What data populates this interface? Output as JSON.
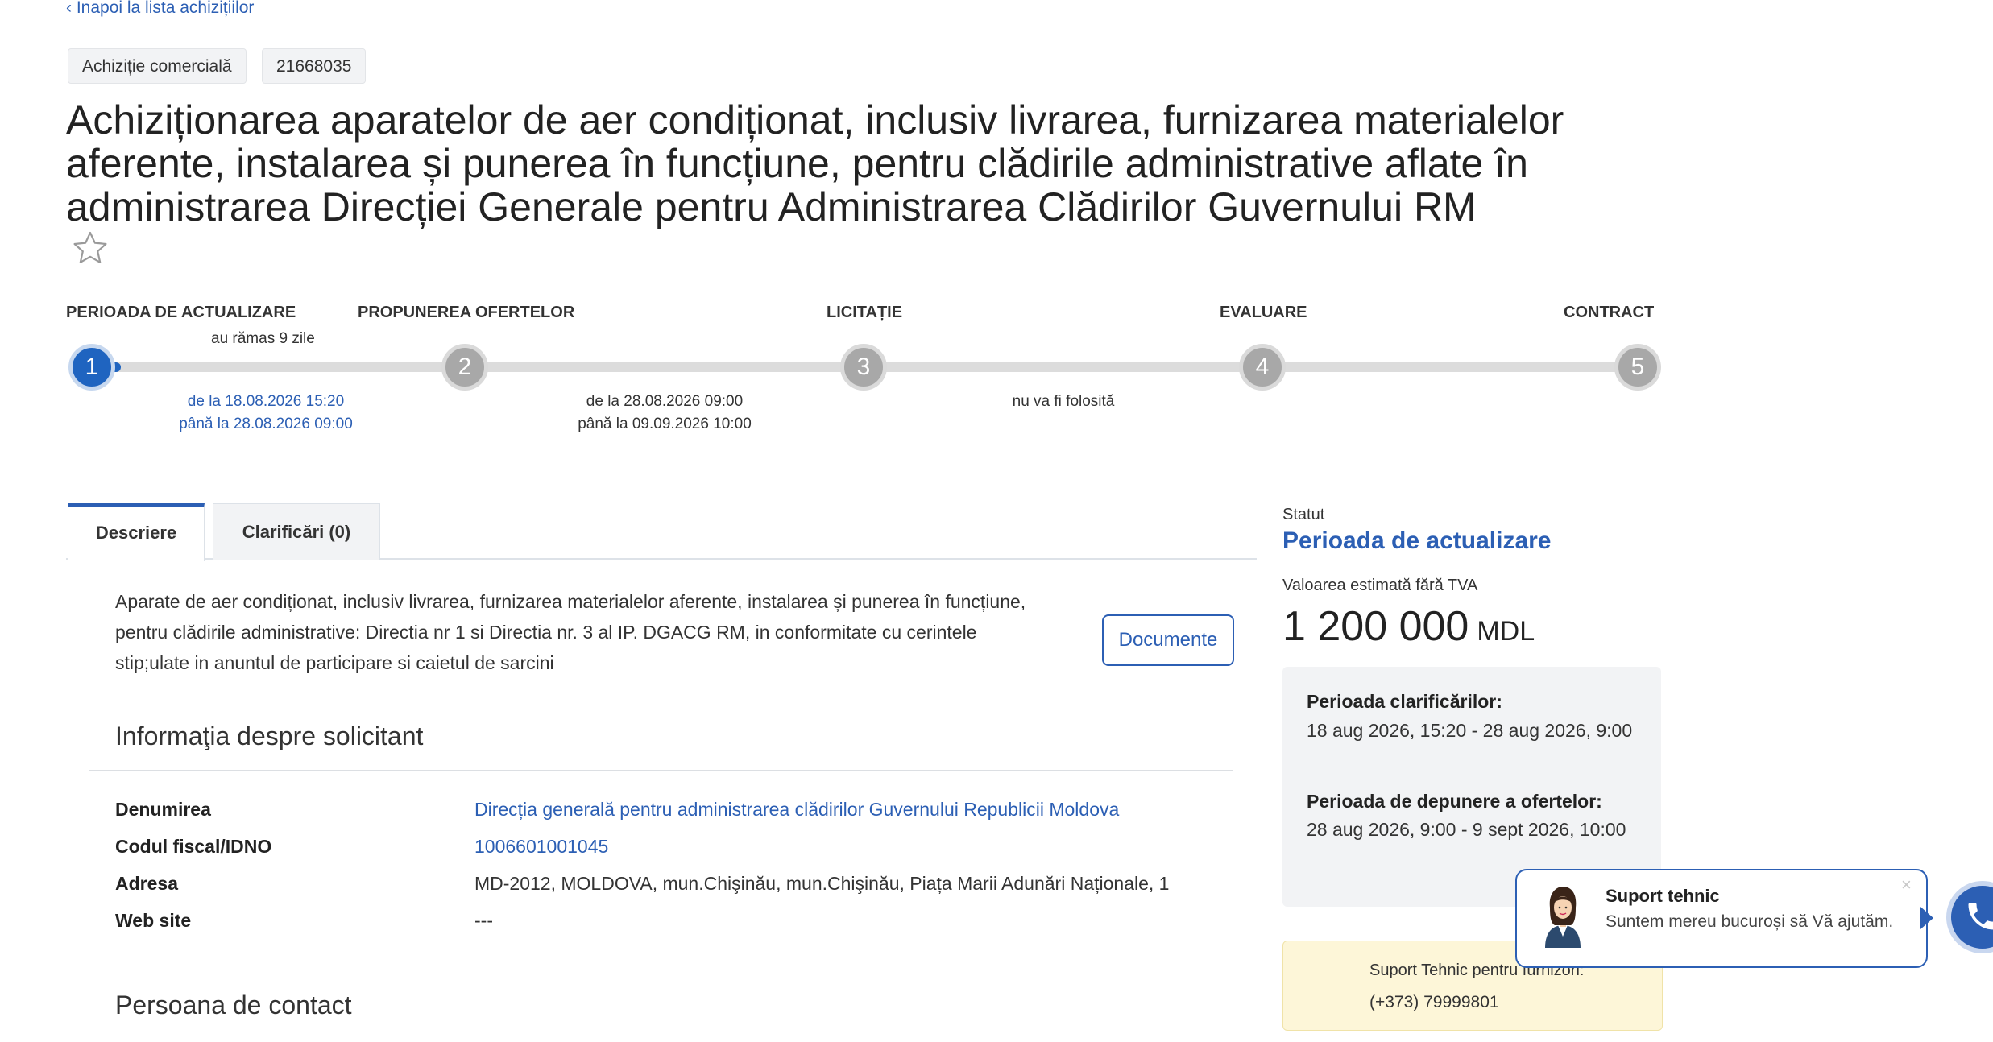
{
  "nav": {
    "back_label": "‹ Înapoi la lista achizițiilor"
  },
  "tags": {
    "type": "Achiziție comercială",
    "id": "21668035"
  },
  "title": "Achiziționarea aparatelor de aer condiționat, inclusiv livrarea, furnizarea materialelor aferente, instalarea și punerea în funcțiune, pentru clădirile administrative aflate în administrarea Direcției Generale pentru Administrarea Clădirilor Guvernului RM",
  "favorite_icon": "star-outline-icon",
  "timeline": {
    "stages": [
      {
        "label": "PERIOADA DE ACTUALIZARE",
        "number": "1"
      },
      {
        "label": "PROPUNEREA OFERTELOR",
        "number": "2"
      },
      {
        "label": "LICITAȚIE",
        "number": "3"
      },
      {
        "label": "EVALUARE",
        "number": "4"
      },
      {
        "label": "CONTRACT",
        "number": "5"
      }
    ],
    "remaining": "au rămas 9 zile",
    "period1_from": "de la 18.08.2026 15:20",
    "period1_to": "până la 28.08.2026 09:00",
    "period2_from": "de la 28.08.2026 09:00",
    "period2_to": "până la 09.09.2026 10:00",
    "auction_note": "nu va fi folosită",
    "colors": {
      "active": "#1f64c0",
      "inactive": "#a8a8a8"
    }
  },
  "tabs": [
    {
      "label": "Descriere",
      "active": true
    },
    {
      "label": "Clarificări (0)",
      "active": false
    }
  ],
  "description": "Aparate de aer condiționat, inclusiv livrarea, furnizarea materialelor aferente, instalarea și punerea în funcțiune, pentru clădirile administrative: Directia nr 1 si Directia nr. 3 al IP. DGACG RM, in conformitate cu cerintele stip;ulate in anuntul de participare si caietul de sarcini",
  "documents_button": "Documente",
  "applicant": {
    "heading": "Informaţia despre solicitant",
    "rows": [
      {
        "label": "Denumirea",
        "value": "Direcția generală pentru administrarea clădirilor Guvernului Republicii Moldova",
        "link": true
      },
      {
        "label": "Codul fiscal/IDNO",
        "value": "1006601001045",
        "link": true
      },
      {
        "label": "Adresa",
        "value": "MD-2012, MOLDOVA, mun.Chişinău, mun.Chişinău, Piața Marii Adunări Naționale, 1",
        "link": false
      },
      {
        "label": "Web site",
        "value": "---",
        "link": false
      }
    ]
  },
  "contact": {
    "heading": "Persoana de contact"
  },
  "sidebar": {
    "status_label": "Statut",
    "status_value": "Perioada de actualizare",
    "estimate_label": "Valoarea estimată fără TVA",
    "amount": "1 200 000",
    "currency": "MDL",
    "clarification_heading": "Perioada clarificărilor:",
    "clarification_value": "18 aug 2026, 15:20 - 28 aug 2026, 9:00",
    "offers_heading": "Perioada de depunere a ofertelor:",
    "offers_value": "28 aug 2026, 9:00 - 9 sept 2026, 10:00",
    "support_box_title": "Suport Tehnic pentru furnizori:",
    "support_box_phone": "(+373) 79999801"
  },
  "support_widget": {
    "title": "Suport tehnic",
    "text": "Suntem mereu bucuroși să Vă ajutăm.",
    "close_icon": "close-icon",
    "avatar_icon": "support-agent-avatar",
    "phone_icon": "phone-icon"
  }
}
